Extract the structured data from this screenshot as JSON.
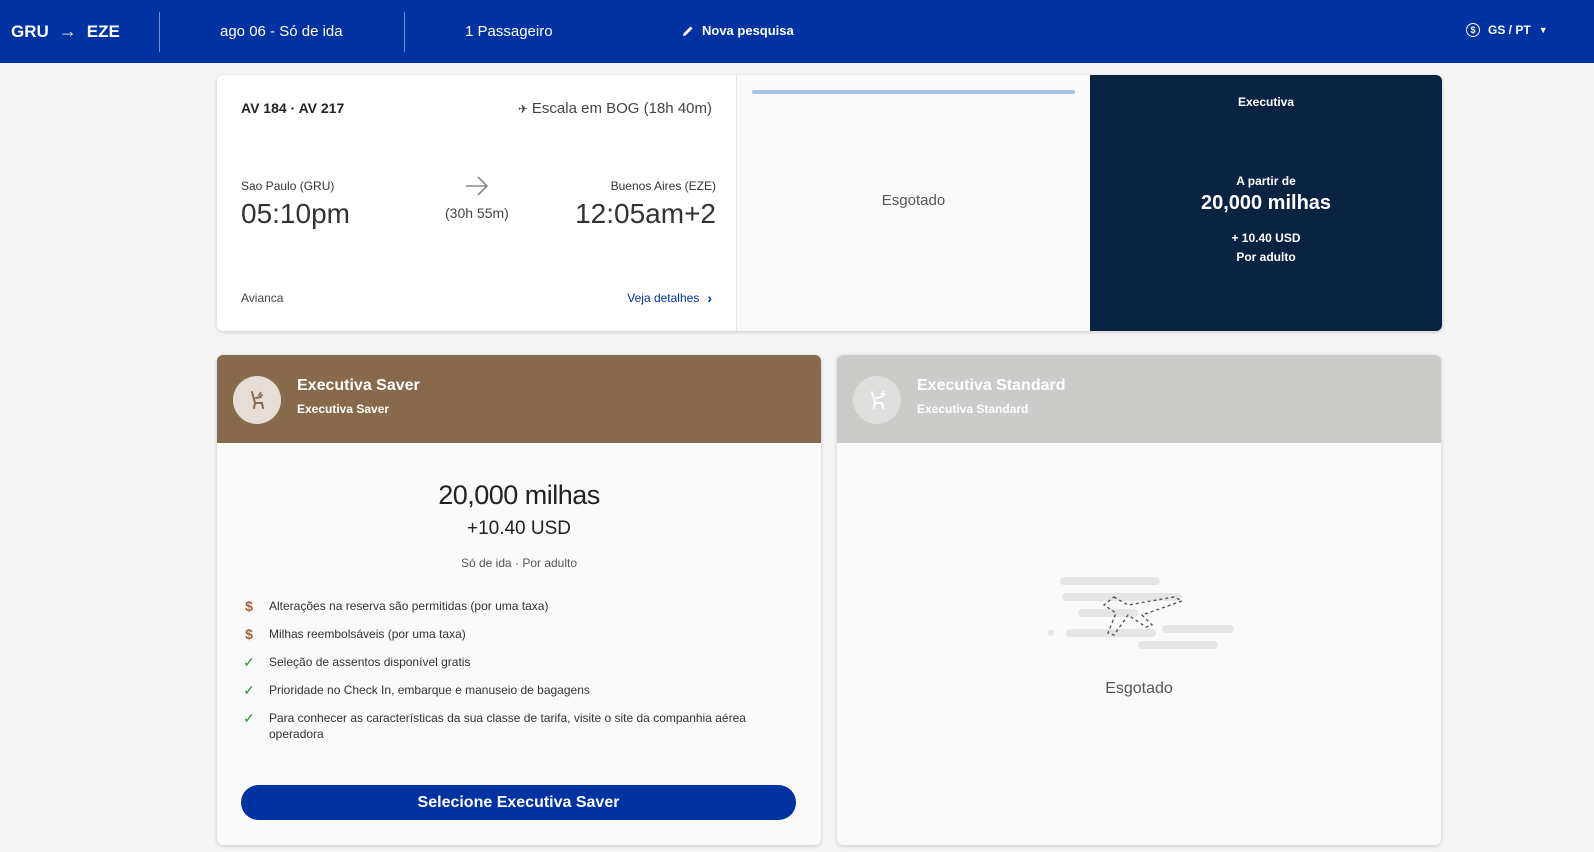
{
  "header": {
    "origin": "GRU",
    "destination": "EZE",
    "date": "ago 06 - Só de ida",
    "passengers": "1 Passageiro",
    "new_search": "Nova pesquisa",
    "locale": "GS / PT",
    "currency_symbol": "$"
  },
  "flight": {
    "numbers": "AV 184 · AV 217",
    "stop": "Escala em BOG (18h 40m)",
    "origin_label": "Sao Paulo (GRU)",
    "departure": "05:10pm",
    "duration": "(30h 55m)",
    "destination_label": "Buenos Aires (EZE)",
    "arrival": "12:05am+2",
    "airline": "Avianca",
    "details_link": "Veja detalhes"
  },
  "cabins": {
    "first_column_status": "Esgotado",
    "executive": {
      "title": "Executiva",
      "from_label": "A partir de",
      "miles": "20,000 milhas",
      "taxes": "+ 10.40 USD",
      "per": "Por adulto"
    }
  },
  "fares": {
    "saver": {
      "name": "Executiva Saver",
      "subtitle": "Executiva Saver",
      "miles": "20,000 milhas",
      "taxes": "+10.40 USD",
      "conditions": "Só de ida · Por adulto",
      "features": [
        {
          "icon": "dollar-icon",
          "text": "Alterações na reserva são permitidas (por uma taxa)"
        },
        {
          "icon": "dollar-icon",
          "text": "Milhas reembolsáveis (por uma taxa)"
        },
        {
          "icon": "check-icon",
          "text": "Seleção de assentos disponível gratis"
        },
        {
          "icon": "check-icon",
          "text": "Prioridade no Check In, embarque e manuseio de bagagens"
        },
        {
          "icon": "check-icon",
          "text": "Para conhecer as características da sua classe de tarifa, visite o site da companhia aérea operadora"
        }
      ],
      "button": "Selecione Executiva Saver"
    },
    "standard": {
      "name": "Executiva Standard",
      "subtitle": "Executiva Standard",
      "status": "Esgotado"
    }
  },
  "colors": {
    "header_bg": "#0033a1",
    "executive_bg": "#0b2342",
    "saver_header": "#87694c",
    "standard_header": "#cbcbc9",
    "button": "#0033a1"
  }
}
